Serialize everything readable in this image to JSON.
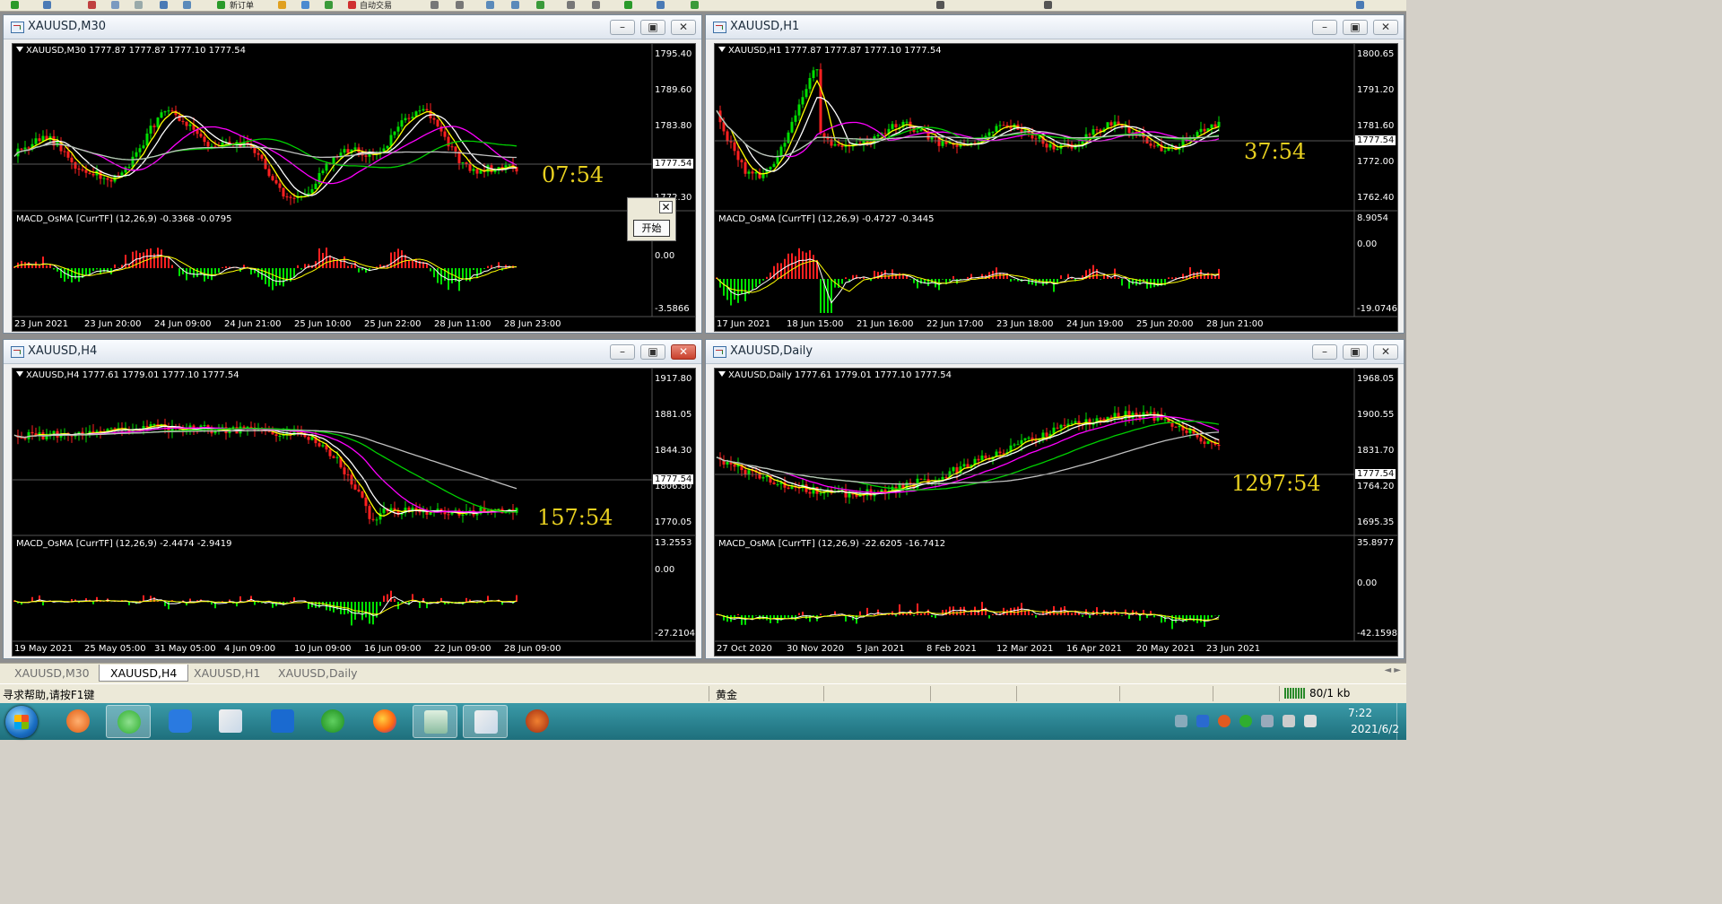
{
  "toolbar": {
    "new_order": "新订单",
    "auto_trading": "自动交易"
  },
  "windows": [
    {
      "key": "m30",
      "title": "XAUUSD,M30",
      "close_red": false,
      "ohlc": "XAUUSD,M30  1777.87 1777.87 1777.10 1777.54",
      "price_labels": [
        "1795.40",
        "1789.60",
        "1783.80",
        "1772.30"
      ],
      "current_price": "1777.54",
      "timer": "07:54",
      "macd_title": "MACD_OsMA [CurrTF] (12,26,9) -0.3368 -0.0795",
      "macd_labels": [
        "0.00",
        "-3.5866"
      ],
      "x_labels": [
        "23 Jun 2021",
        "23 Jun 20:00",
        "24 Jun 09:00",
        "24 Jun 21:00",
        "25 Jun 10:00",
        "25 Jun 22:00",
        "28 Jun 11:00",
        "28 Jun 23:00"
      ]
    },
    {
      "key": "h1",
      "title": "XAUUSD,H1",
      "close_red": false,
      "ohlc": "XAUUSD,H1  1777.87 1777.87 1777.10 1777.54",
      "price_labels": [
        "1800.65",
        "1791.20",
        "1781.60",
        "1772.00",
        "1762.40"
      ],
      "current_price": "1777.54",
      "timer": "37:54",
      "macd_title": "MACD_OsMA [CurrTF] (12,26,9) -0.4727 -0.3445",
      "macd_labels": [
        "8.9054",
        "0.00",
        "-19.0746"
      ],
      "x_labels": [
        "17 Jun 2021",
        "18 Jun 15:00",
        "21 Jun 16:00",
        "22 Jun 17:00",
        "23 Jun 18:00",
        "24 Jun 19:00",
        "25 Jun 20:00",
        "28 Jun 21:00"
      ]
    },
    {
      "key": "h4",
      "title": "XAUUSD,H4",
      "close_red": true,
      "ohlc": "XAUUSD,H4  1777.61 1779.01 1777.10 1777.54",
      "price_labels": [
        "1917.80",
        "1881.05",
        "1844.30",
        "1806.80",
        "1770.05"
      ],
      "current_price": "1777.54",
      "timer": "157:54",
      "macd_title": "MACD_OsMA [CurrTF] (12,26,9) -2.4474 -2.9419",
      "macd_labels": [
        "13.2553",
        "0.00",
        "-27.2104"
      ],
      "x_labels": [
        "19 May 2021",
        "25 May 05:00",
        "31 May 05:00",
        "4 Jun 09:00",
        "10 Jun 09:00",
        "16 Jun 09:00",
        "22 Jun 09:00",
        "28 Jun 09:00"
      ]
    },
    {
      "key": "d1",
      "title": "XAUUSD,Daily",
      "close_red": false,
      "ohlc": "XAUUSD,Daily  1777.61 1779.01 1777.10 1777.54",
      "price_labels": [
        "1968.05",
        "1900.55",
        "1831.70",
        "1764.20",
        "1695.35"
      ],
      "current_price": "1777.54",
      "timer": "1297:54",
      "macd_title": "MACD_OsMA [CurrTF] (12,26,9) -22.6205 -16.7412",
      "macd_labels": [
        "35.8977",
        "0.00",
        "-42.1598"
      ],
      "x_labels": [
        "27 Oct 2020",
        "30 Nov 2020",
        "5 Jan 2021",
        "8 Feb 2021",
        "12 Mar 2021",
        "16 Apr 2021",
        "20 May 2021",
        "23 Jun 2021"
      ]
    }
  ],
  "popup": {
    "close": "✕",
    "start": "开始"
  },
  "tabs": [
    "XAUUSD,M30",
    "XAUUSD,H4",
    "XAUUSD,H1",
    "XAUUSD,Daily"
  ],
  "active_tab": 1,
  "status": {
    "help": "寻求帮助,请按F1键",
    "symbol": "黄金",
    "traffic": "80/1 kb"
  },
  "clock": {
    "time": "7:22",
    "date": "2021/6/2"
  },
  "colors": {
    "bull": "#00e000",
    "bear": "#ff2020",
    "fast_ma": "#ffff00",
    "mid_ma": "#ff00ff",
    "slow_ma": "#00d000",
    "slowest_ma": "#c0c0c0",
    "timer": "#e8d020"
  }
}
